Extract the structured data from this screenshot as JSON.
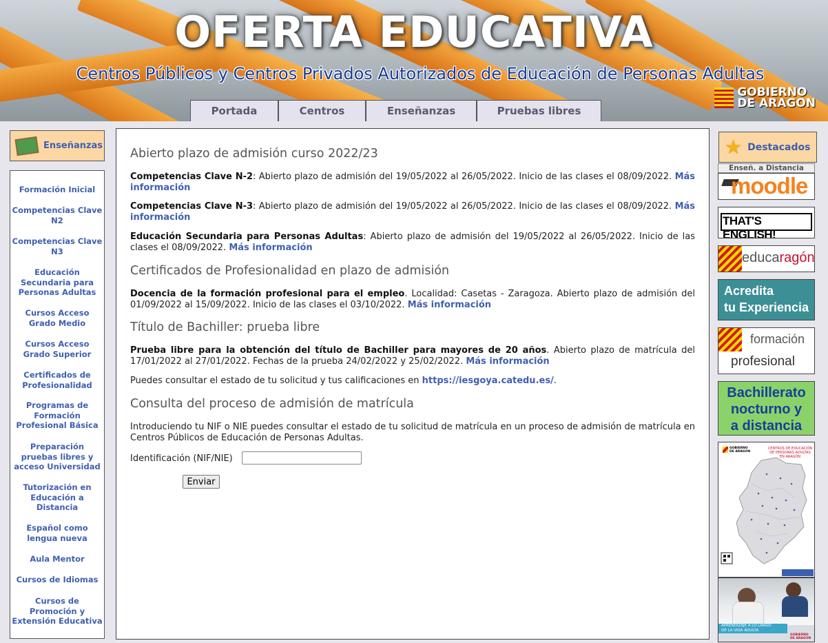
{
  "header": {
    "title": "OFERTA EDUCATIVA",
    "subtitle": "Centros Públicos y Centros Privados Autorizados de Educación de Personas Adultas",
    "logo_line1": "GOBIERNO",
    "logo_line2": "DE ARAGON"
  },
  "tabs": [
    {
      "label": "Portada"
    },
    {
      "label": "Centros"
    },
    {
      "label": "Enseñanzas"
    },
    {
      "label": "Pruebas libres"
    }
  ],
  "left_sidebar": {
    "heading": "Enseñanzas",
    "items": [
      {
        "line1": "Formación Inicial"
      },
      {
        "line1": "Competencias Clave",
        "line2": "N2"
      },
      {
        "line1": "Competencias Clave",
        "line2": "N3"
      },
      {
        "line1": "Educación",
        "line2": "Secundaria para",
        "line3": "Personas Adultas"
      },
      {
        "line1": "Cursos Acceso",
        "line2": "Grado Medio"
      },
      {
        "line1": "Cursos Acceso",
        "line2": "Grado Superior"
      },
      {
        "line1": "Certificados de",
        "line2": "Profesionalidad"
      },
      {
        "line1": "Programas de",
        "line2": "Formación",
        "line3": "Profesional Básica"
      },
      {
        "line1": "Preparación",
        "line2": "pruebas libres y",
        "line3": "acceso Universidad"
      },
      {
        "line1": "Tutorización en",
        "line2": "Educación a",
        "line3": "Distancia"
      },
      {
        "line1": "Español como",
        "line2": "lengua nueva"
      },
      {
        "line1": "Aula Mentor"
      },
      {
        "line1": "Cursos de Idiomas"
      },
      {
        "line1": "Cursos de",
        "line2": "Promoción y",
        "line3": "Extensión Educativa"
      }
    ]
  },
  "main": {
    "section1": {
      "title": "Abierto plazo de admisión curso 2022/23",
      "items": [
        {
          "bold": "Competencias Clave N-2",
          "text": ": Abierto plazo de admisión del 19/05/2022 al 26/05/2022. Inicio de las clases el 08/09/2022. ",
          "link": "Más información"
        },
        {
          "bold": "Competencias Clave N-3",
          "text": ": Abierto plazo de admisión del 19/05/2022 al 26/05/2022. Inicio de las clases el 08/09/2022. ",
          "link": "Más información"
        },
        {
          "bold": "Educación Secundaria para Personas Adultas",
          "text": ": Abierto plazo de admisión del 19/05/2022 al 26/05/2022. Inicio de las clases el 08/09/2022. ",
          "link": "Más información"
        }
      ]
    },
    "section2": {
      "title": "Certificados de Profesionalidad en plazo de admisión",
      "item": {
        "bold": "Docencia de la formación profesional para el empleo",
        "text": ". Localidad: Casetas - Zaragoza. Abierto plazo de admisión del 01/09/2022 al 15/09/2022. Inicio de las clases el 03/10/2022. ",
        "link": "Más información"
      }
    },
    "section3": {
      "title": "Título de Bachiller: prueba libre",
      "item": {
        "bold": "Prueba libre para la obtención del título de Bachiller para mayores de 20 años",
        "text": ". Abierto plazo de matrícula del 17/01/2022 al 27/01/2022. Fechas de la prueba 24/02/2022 y 25/02/2022. ",
        "link": "Más información"
      },
      "note_text": "Puedes consultar el estado de tu solicitud y tus calificaciones en ",
      "note_link": "https://iesgoya.catedu.es/",
      "note_end": "."
    },
    "section4": {
      "title": "Consulta del proceso de admisión de matrícula",
      "text": "Introduciendo tu NIF o NIE puedes consultar el estado de tu solicitud de matrícula en un proceso de admisión de matrícula en Centros Públicos de Educación de Personas Adultas.",
      "field_label": "Identificación (NIF/NIE)",
      "field_value": "",
      "submit_label": "Enviar"
    }
  },
  "right_sidebar": {
    "heading": "Destacados",
    "distancia_label": "Enseñ. a Distancia",
    "moodle": "moodle",
    "thats_english": "THAT'S ENGLISH!",
    "educaragon_1": "educa",
    "educaragon_2": "ragón",
    "acredita_1": "Acredita",
    "acredita_2": "tu Experiencia",
    "fp_1": "formación",
    "fp_2": "profesional",
    "bach_1": "Bachillerato",
    "bach_2": "nocturno y",
    "bach_3": "a distancia",
    "map_title_1": "CENTROS DE EDUCACIÓN",
    "map_title_2": "DE PERSONAS ADULTAS",
    "map_title_3": "EN ARAGÓN",
    "map_logo_1": "GOBIERNO",
    "map_logo_2": "DE ARAGON",
    "photo_caption_1": "APRENDIZAJE A LO LARGO",
    "photo_caption_2": "DE LA VIDA ADULTA",
    "photo_logo": "GOBIERNO DE ARAGON"
  },
  "colors": {
    "link": "#3f5fb0",
    "heading_box": "#fcd7a4",
    "tab_bg": "#e4e2ee",
    "page_bg": "#e6e6ec"
  }
}
